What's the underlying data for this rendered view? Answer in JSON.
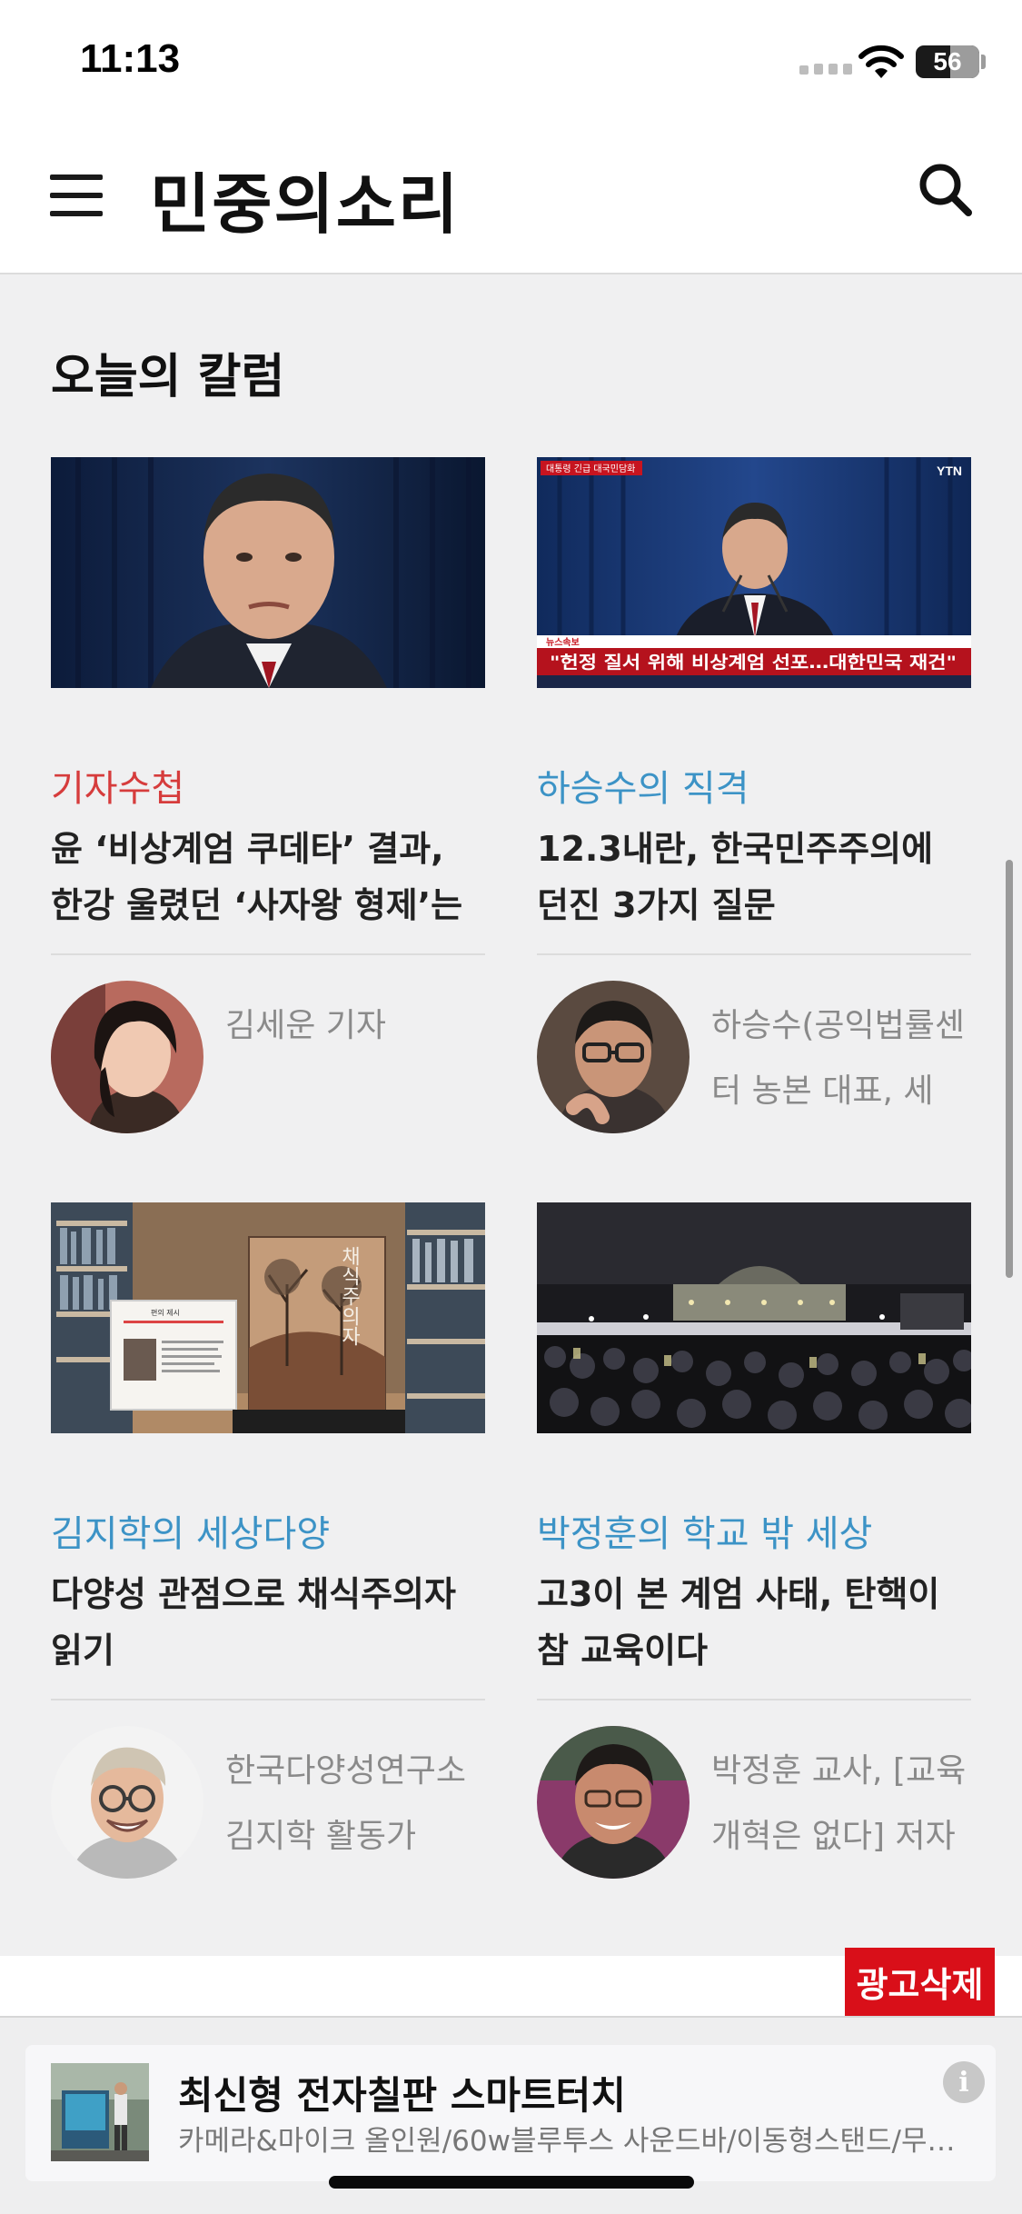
{
  "status_bar": {
    "time": "11:13",
    "battery": "56"
  },
  "header": {
    "brand": "민중의소리"
  },
  "section": {
    "title": "오늘의 칼럼"
  },
  "columns": [
    {
      "category": "기자수첩",
      "title": "윤 ‘비상계엄 쿠데타’ 결과, 한강 울렸던 ‘사자왕 형제’는 ...",
      "author": "김세운 기자"
    },
    {
      "category": "하승수의 직격",
      "title": "12.3내란, 한국민주주의에 던진 3가지 질문",
      "author": "하승수(공익법률센터 농본 대표, 세금..."
    },
    {
      "category": "김지학의 세상다양",
      "title": "다양성 관점으로 채식주의자 읽기",
      "author": "한국다양성연구소 김지학 활동가 민..."
    },
    {
      "category": "박정훈의 학교 밖 세상",
      "title": "고3이 본 계엄 사태, 탄핵이 참 교육이다",
      "author": "박정훈 교사, [교육개혁은 없다] 저자 민..."
    }
  ],
  "thumb_text": {
    "news_caption": "\"헌정 질서 위해 비상계엄 선포…대한민국 재건\"",
    "news_tag": "대통령 긴급 대국민담화",
    "news_small": "뉴스속보",
    "ytn": "YTN",
    "book_title": "채식주의자",
    "book_card": "편의 제시"
  },
  "ad": {
    "remove_label": "광고삭제",
    "title": "최신형 전자칠판 스마트터치",
    "description": "카메라&마이크 올인원/60w블루투스 사운드바/이동형스탠드/무…",
    "info": "i"
  },
  "colors": {
    "category_red": "#d63c3c",
    "category_blue": "#3c93c6",
    "ad_red": "#d90f19"
  }
}
